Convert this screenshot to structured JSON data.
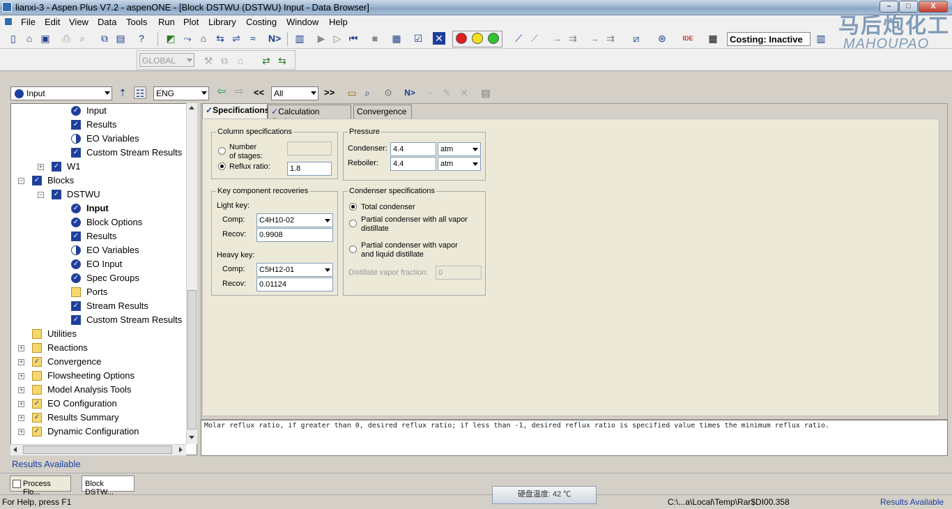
{
  "window": {
    "title": "lianxi-3 - Aspen Plus V7.2 - aspenONE - [Block DSTWU (DSTWU) Input - Data Browser]",
    "buttons": [
      "–",
      "□",
      "X"
    ]
  },
  "menu": [
    "File",
    "Edit",
    "View",
    "Data",
    "Tools",
    "Run",
    "Plot",
    "Library",
    "Costing",
    "Window",
    "Help"
  ],
  "toolbar": {
    "costing_status": "Costing: Inactive",
    "global_combo": "GLOBAL",
    "next_label": "N>"
  },
  "logo": {
    "text_cn": "马后炮化工",
    "text_en": "MAHOUPAO"
  },
  "browser": {
    "form_combo": "Input",
    "units_combo": "ENG",
    "filter_combo": "All",
    "prev_label": "<<",
    "next_label": ">>",
    "next_step_label": "N>"
  },
  "tree": {
    "items": [
      {
        "label": "Input",
        "level": 3,
        "icon": "check-circle-icon"
      },
      {
        "label": "Results",
        "level": 3,
        "icon": "check-box-icon"
      },
      {
        "label": "EO Variables",
        "level": 3,
        "icon": "half-circle-icon"
      },
      {
        "label": "Custom Stream Results",
        "level": 3,
        "icon": "check-box-icon"
      },
      {
        "label": "W1",
        "level": 2,
        "icon": "stream-icon"
      },
      {
        "label": "Blocks",
        "level": 1,
        "icon": "blocks-icon"
      },
      {
        "label": "DSTWU",
        "level": 2,
        "icon": "block-icon"
      },
      {
        "label": "Input",
        "level": 3,
        "icon": "check-circle-icon",
        "bold": true
      },
      {
        "label": "Block Options",
        "level": 3,
        "icon": "check-circle-icon"
      },
      {
        "label": "Results",
        "level": 3,
        "icon": "check-box-icon"
      },
      {
        "label": "EO Variables",
        "level": 3,
        "icon": "half-circle-icon"
      },
      {
        "label": "EO Input",
        "level": 3,
        "icon": "check-circle-icon"
      },
      {
        "label": "Spec Groups",
        "level": 3,
        "icon": "check-circle-icon"
      },
      {
        "label": "Ports",
        "level": 3,
        "icon": "folder-icon"
      },
      {
        "label": "Stream Results",
        "level": 3,
        "icon": "check-box-icon"
      },
      {
        "label": "Custom Stream Results",
        "level": 3,
        "icon": "check-box-icon"
      },
      {
        "label": "Utilities",
        "level": 1,
        "icon": "folder-icon"
      },
      {
        "label": "Reactions",
        "level": 1,
        "icon": "folder-icon"
      },
      {
        "label": "Convergence",
        "level": 1,
        "icon": "checked-folder-icon"
      },
      {
        "label": "Flowsheeting Options",
        "level": 1,
        "icon": "folder-icon"
      },
      {
        "label": "Model Analysis Tools",
        "level": 1,
        "icon": "folder-icon"
      },
      {
        "label": "EO Configuration",
        "level": 1,
        "icon": "checked-folder-icon"
      },
      {
        "label": "Results Summary",
        "level": 1,
        "icon": "checked-folder-icon"
      },
      {
        "label": "Dynamic Configuration",
        "level": 1,
        "icon": "checked-folder-icon"
      }
    ],
    "status": "Results Available"
  },
  "tabs": [
    "Specifications",
    "Calculation Options",
    "Convergence"
  ],
  "column_specs": {
    "legend": "Column specifications",
    "stages_label_1": "Number",
    "stages_label_2": "of stages:",
    "stages_value": "",
    "reflux_label": "Reflux ratio:",
    "reflux_value": "1.8"
  },
  "pressure": {
    "legend": "Pressure",
    "condenser_label": "Condenser:",
    "condenser_value": "4.4",
    "condenser_unit": "atm",
    "reboiler_label": "Reboiler:",
    "reboiler_value": "4.4",
    "reboiler_unit": "atm"
  },
  "key_recoveries": {
    "legend": "Key component recoveries",
    "light_key_label": "Light key:",
    "light_comp_label": "Comp:",
    "light_comp": "C4H10-02",
    "light_recov_label": "Recov:",
    "light_recov": "0.9908",
    "heavy_key_label": "Heavy key:",
    "heavy_comp_label": "Comp:",
    "heavy_comp": "C5H12-01",
    "heavy_recov_label": "Recov:",
    "heavy_recov": "0.01124"
  },
  "condenser_specs": {
    "legend": "Condenser specifications",
    "total": "Total condenser",
    "partial_vapor_1": "Partial condenser with all vapor",
    "partial_vapor_2": "distillate",
    "partial_mixed_1": "Partial condenser with vapor",
    "partial_mixed_2": "and liquid distillate",
    "vapor_fraction_label": "Distillate vapor fraction:",
    "vapor_fraction_value": "0"
  },
  "help_text": "Molar reflux ratio, if greater than 0, desired reflux ratio; if less than -1, desired reflux ratio is specified value times the minimum reflux ratio.",
  "taskbar": [
    "Process Flo...",
    "Block DSTW..."
  ],
  "statusbar": {
    "help": "For Help, press F1",
    "temp": "硬盘温度: 42 ℃",
    "path": "C:\\...a\\Local\\Temp\\Rar$DI00.358",
    "results": "Results Available"
  }
}
